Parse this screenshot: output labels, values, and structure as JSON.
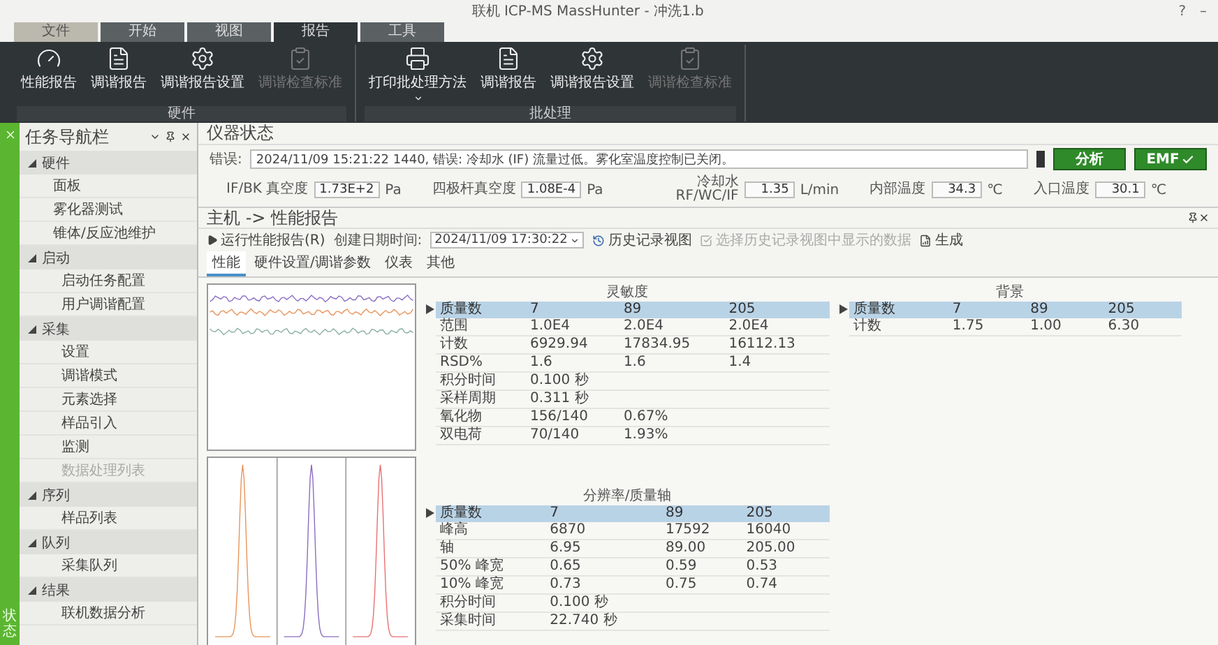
{
  "window": {
    "title": "联机 ICP-MS MassHunter - 冲洗1.b",
    "controls": [
      "?",
      "–"
    ]
  },
  "ribbon": {
    "tabs": [
      {
        "label": "文件",
        "selected": false
      },
      {
        "label": "开始",
        "selected": false
      },
      {
        "label": "视图",
        "selected": false
      },
      {
        "label": "报告",
        "selected": true
      },
      {
        "label": "工具",
        "selected": false
      }
    ],
    "groups": [
      {
        "label": "硬件",
        "buttons": [
          {
            "label": "性能报告",
            "kind": "gauge",
            "disabled": false
          },
          {
            "label": "调谐报告",
            "kind": "tune",
            "disabled": false
          },
          {
            "label": "调谐报告设置",
            "kind": "settings",
            "disabled": false
          },
          {
            "label": "调谐检查标准",
            "kind": "check",
            "disabled": true
          }
        ]
      },
      {
        "label": "批处理",
        "buttons": [
          {
            "label": "打印批处理方法",
            "kind": "print",
            "disabled": false
          },
          {
            "label": "调谐报告",
            "kind": "tune",
            "disabled": false
          },
          {
            "label": "调谐报告设置",
            "kind": "settings",
            "disabled": false
          },
          {
            "label": "调谐检查标准",
            "kind": "check",
            "disabled": true
          }
        ]
      }
    ]
  },
  "side_strip": {
    "label": "状态"
  },
  "nav": {
    "title": "任务导航栏",
    "sections": [
      {
        "label": "硬件",
        "expanded": true,
        "items": [
          {
            "label": "面板",
            "disabled": false
          },
          {
            "label": "雾化器测试",
            "disabled": false
          },
          {
            "label": "锥体/反应池维护",
            "disabled": false
          }
        ]
      },
      {
        "label": "启动",
        "expanded": true,
        "items": [
          {
            "label": "启动任务配置",
            "disabled": false
          },
          {
            "label": "用户调谐配置",
            "disabled": false
          }
        ]
      },
      {
        "label": "采集",
        "expanded": true,
        "items": [
          {
            "label": "设置",
            "disabled": false
          },
          {
            "label": "调谐模式",
            "disabled": false
          },
          {
            "label": "元素选择",
            "disabled": false
          },
          {
            "label": "样品引入",
            "disabled": false
          },
          {
            "label": "监测",
            "disabled": false
          },
          {
            "label": "数据处理列表",
            "disabled": true
          }
        ]
      },
      {
        "label": "序列",
        "expanded": true,
        "items": [
          {
            "label": "样品列表",
            "disabled": false
          }
        ]
      },
      {
        "label": "队列",
        "expanded": true,
        "items": [
          {
            "label": "采集队列",
            "disabled": false
          }
        ]
      },
      {
        "label": "结果",
        "expanded": true,
        "items": [
          {
            "label": "联机数据分析",
            "disabled": false
          }
        ]
      }
    ]
  },
  "status": {
    "title": "仪器状态",
    "error_label": "错误:",
    "error_text": "2024/11/09 15:21:22 1440, 错误: 冷却水 (IF) 流量过低。雾化室温度控制已关闭。",
    "buttons": [
      {
        "label": "分析",
        "kind": "plain"
      },
      {
        "label": "EMF",
        "kind": "check"
      }
    ],
    "readings": [
      {
        "label": "IF/BK 真空度",
        "value": "1.73E+2",
        "unit": "Pa"
      },
      {
        "label": "四极杆真空度",
        "value": "1.08E-4",
        "unit": "Pa"
      },
      {
        "label": "冷却水 RF/WC/IF",
        "value": "1.35",
        "unit": "L/min"
      },
      {
        "label": "内部温度",
        "value": "34.3",
        "unit": "℃"
      },
      {
        "label": "入口温度",
        "value": "30.1",
        "unit": "℃"
      }
    ]
  },
  "report": {
    "title": "主机 -> 性能报告",
    "run": "运行性能报告(R)",
    "date_label": "创建日期时间:",
    "date_value": "2024/11/09 17:30:22",
    "history": "历史记录视图",
    "select": {
      "label": "选择历史记录视图中显示的数据",
      "disabled": true
    },
    "generate": "生成",
    "tabs": [
      {
        "label": "性能",
        "selected": true
      },
      {
        "label": "硬件设置/调谐参数",
        "selected": false
      },
      {
        "label": "仪表",
        "selected": false
      },
      {
        "label": "其他",
        "selected": false
      }
    ],
    "sensitivity": {
      "title": "灵敏度",
      "columns": [
        "质量数",
        "7",
        "89",
        "205"
      ],
      "rows": [
        [
          "范围",
          "1.0E4",
          "2.0E4",
          "2.0E4"
        ],
        [
          "计数",
          "6929.94",
          "17834.95",
          "16112.13"
        ],
        [
          "RSD%",
          "1.6",
          "1.6",
          "1.4"
        ],
        [
          "积分时间",
          "0.100 秒",
          "",
          ""
        ],
        [
          "采样周期",
          "0.311 秒",
          "",
          ""
        ],
        [
          "氧化物",
          "156/140",
          "0.67%",
          ""
        ],
        [
          "双电荷",
          "70/140",
          "1.93%",
          ""
        ]
      ]
    },
    "background": {
      "title": "背景",
      "columns": [
        "质量数",
        "7",
        "89",
        "205"
      ],
      "rows": [
        [
          "计数",
          "1.75",
          "1.00",
          "6.30"
        ]
      ]
    },
    "resolution": {
      "title": "分辨率/质量轴",
      "columns": [
        "质量数",
        "7",
        "89",
        "205"
      ],
      "rows": [
        [
          "峰高",
          "6870",
          "17592",
          "16040"
        ],
        [
          "轴",
          "6.95",
          "89.00",
          "205.00"
        ],
        [
          "50% 峰宽",
          "0.65",
          "0.59",
          "0.53"
        ],
        [
          "10% 峰宽",
          "0.73",
          "0.75",
          "0.74"
        ],
        [
          "积分时间",
          "0.100 秒",
          "",
          ""
        ],
        [
          "采集时间",
          "22.740 秒",
          "",
          ""
        ]
      ]
    }
  }
}
